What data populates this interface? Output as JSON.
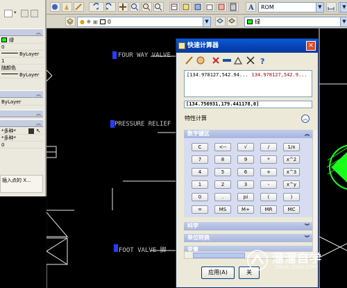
{
  "toolbar": {
    "style_value": "ROM",
    "color_value": "0",
    "layer_color_value": "绿"
  },
  "properties": {
    "color": "绿",
    "layer": "0",
    "linetype": "ByLayer",
    "linetype_scale": "1",
    "plot_style": "随颜色",
    "lineweight": "ByLayer",
    "plot_style_2": "ByLayer",
    "multi_value_1": "*多种*",
    "multi_value_2": "*多种*",
    "value_0": "0",
    "hint": "插入点的 X..."
  },
  "canvas": {
    "labels": [
      "FOUR WAY VALVE",
      "PRESSURE RELIEF",
      "FOOT VALVE 脚"
    ]
  },
  "calc": {
    "title": "快速计算器",
    "close_label": "×",
    "history_expression": "[134.978127,542.94...",
    "history_result": "134.978127,542.9...",
    "input_value": "[134.756931,179.441178,0]",
    "functions_label": "特性计算",
    "keypad_header": "数字键区",
    "keys": [
      [
        "C",
        "<--",
        "√",
        "/",
        "1/x"
      ],
      [
        "7",
        "8",
        "9",
        "*",
        "x^2"
      ],
      [
        "4",
        "5",
        "6",
        "+",
        "x^3"
      ],
      [
        "1",
        "2",
        "3",
        "-",
        "x^y"
      ],
      [
        "0",
        ".",
        "pi",
        "(",
        ")"
      ],
      [
        "=",
        "MS",
        "M+",
        "MR",
        "MC"
      ]
    ],
    "sections": [
      "科学",
      "单位转换",
      "变量"
    ],
    "apply_button": "应用(A)",
    "close_button": "关"
  },
  "watermark": {
    "brand": "溜溜自学",
    "url": "ZIXUE.3D66.COM"
  },
  "colors": {
    "background": "#000000",
    "label": "#c8c8c8",
    "green": "#19ff19",
    "marker": "#2a3cff"
  }
}
